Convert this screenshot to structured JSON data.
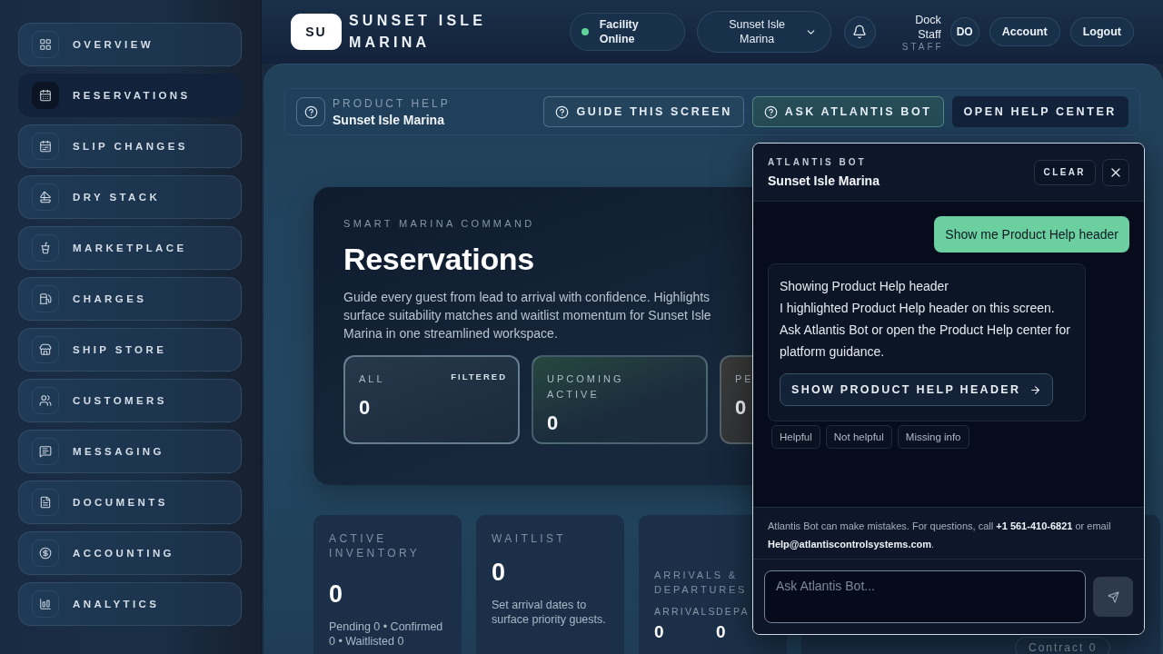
{
  "sidebar": {
    "items": [
      {
        "label": "OVERVIEW",
        "selected": false
      },
      {
        "label": "RESERVATIONS",
        "selected": true
      },
      {
        "label": "SLIP CHANGES",
        "selected": false
      },
      {
        "label": "DRY STACK",
        "selected": false
      },
      {
        "label": "MARKETPLACE",
        "selected": false
      },
      {
        "label": "CHARGES",
        "selected": false
      },
      {
        "label": "SHIP STORE",
        "selected": false
      },
      {
        "label": "CUSTOMERS",
        "selected": false
      },
      {
        "label": "MESSAGING",
        "selected": false
      },
      {
        "label": "DOCUMENTS",
        "selected": false
      },
      {
        "label": "ACCOUNTING",
        "selected": false
      },
      {
        "label": "ANALYTICS",
        "selected": false
      }
    ]
  },
  "header": {
    "brand": {
      "initials": "SU",
      "name": "SUNSET ISLE MARINA"
    },
    "status": {
      "label": "Facility Online",
      "online": true
    },
    "location_select": {
      "value": "Sunset Isle Marina"
    },
    "user": {
      "name": "Dock Staff",
      "role": "STAFF",
      "initials": "DO"
    },
    "buttons": [
      "Account",
      "Logout"
    ]
  },
  "help_bar": {
    "eyebrow": "PRODUCT HELP",
    "title": "Sunset Isle Marina",
    "actions": [
      {
        "label": "GUIDE THIS SCREEN",
        "kind": "icon",
        "selected": false
      },
      {
        "label": "ASK ATLANTIS BOT",
        "kind": "icon",
        "selected": true
      },
      {
        "label": "OPEN HELP CENTER",
        "kind": "plain",
        "selected": false
      }
    ]
  },
  "hero": {
    "eyebrow": "SMART MARINA COMMAND",
    "title": "Reservations",
    "description": "Guide every guest from lead to arrival with confidence. Highlights surface suitability matches and waitlist momentum for Sunset Isle Marina in one streamlined workspace.",
    "tiles": [
      {
        "label": "ALL",
        "tag": "FILTERED",
        "value": "0",
        "kind": "neutral"
      },
      {
        "label": "UPCOMING ACTIVE",
        "value": "0",
        "kind": "positive"
      },
      {
        "label": "PE",
        "value": "0",
        "kind": "warning"
      }
    ]
  },
  "cards": [
    {
      "kind": "stat",
      "label": "ACTIVE INVENTORY",
      "value": "0",
      "note": "Pending 0 • Confirmed 0 • Waitlisted 0"
    },
    {
      "kind": "stat",
      "label": "WAITLIST",
      "value": "0",
      "note": "Set arrival dates to surface priority guests."
    },
    {
      "kind": "split",
      "label": "ARRIVALS & DEPARTURES",
      "columns": [
        {
          "label": "ARRIVALS",
          "value": "0"
        },
        {
          "label": "DEPA",
          "value": "0"
        }
      ]
    },
    {
      "kind": "notes",
      "pill": "Contract 0"
    }
  ],
  "chat": {
    "eyebrow": "ATLANTIS BOT",
    "title": "Sunset Isle Marina",
    "clear": "CLEAR",
    "messages": [
      {
        "kind": "user",
        "text": "Show me Product Help header"
      },
      {
        "kind": "bot",
        "title": "Showing Product Help header",
        "text": "I highlighted Product Help header on this screen. Ask Atlantis Bot or open the Product Help center for platform guidance.",
        "action": "SHOW PRODUCT HELP HEADER",
        "feedback": [
          "Helpful",
          "Not helpful",
          "Missing info"
        ]
      }
    ],
    "disclaimer": "Atlantis Bot can make mistakes. For questions, call **+1 561-410-6821** or email **Help@atlantiscontrolsystems.com**.",
    "input": {
      "placeholder": "Ask Atlantis Bot..."
    }
  }
}
